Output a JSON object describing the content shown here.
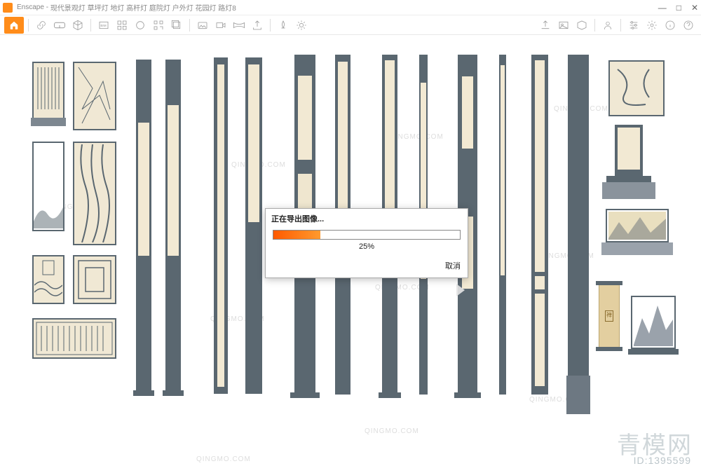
{
  "titlebar": {
    "app_name": "Enscape",
    "doc_title": "现代景观灯 草坪灯 地灯 高杆灯 庭院灯 户外灯 花园灯 路灯8"
  },
  "window_controls": {
    "min": "—",
    "max": "□",
    "close": "✕"
  },
  "toolbar": {
    "icons": [
      "home",
      "link",
      "spectacles",
      "cube",
      "divider",
      "video-settings",
      "picture-capture",
      "mono",
      "qr",
      "batch",
      "divider",
      "image",
      "video",
      "pano",
      "link2",
      "divider",
      "tree",
      "sun",
      "arrow-down",
      "divider",
      "settings",
      "gear",
      "info",
      "help"
    ]
  },
  "dialog": {
    "title": "正在导出图像...",
    "percent_label": "25%",
    "percent_value": 25,
    "cancel": "取消"
  },
  "watermarks": {
    "repeat": "QINGMO.COM",
    "logo": "青模网",
    "id": "ID:1395599"
  }
}
